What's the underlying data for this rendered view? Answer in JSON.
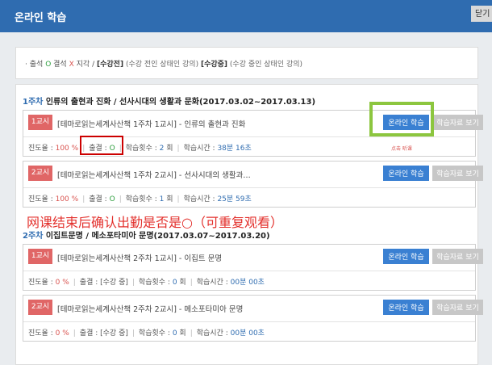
{
  "header": {
    "title": "온라인 학습",
    "close_label": "닫기"
  },
  "legend": {
    "bullet": "·",
    "attendance": "출석",
    "o": "O",
    "absent": "결석",
    "x": "X",
    "late": "지각",
    "slash": "/",
    "completed_tag": "[수강전]",
    "completed_desc": "(수강 전인 상태인 강의)",
    "ongoing_tag": "[수강중]",
    "ongoing_desc": "(수강 중인 상태인 강의)"
  },
  "weeks": [
    {
      "num": "1주차",
      "title": "인류의 출현과 진화 / 선사시대의 생활과 문화(2017.03.02~2017.03.13)",
      "lessons": [
        {
          "badge": "1교시",
          "title": "[테마로읽는세계사산책 1주차 1교시] - 인류의 출현과 진화",
          "progress_label": "진도율 :",
          "progress": "100 %",
          "att_label": "출결 :",
          "att": "O",
          "count_label": "학습횟수 :",
          "count": "2",
          "count_unit": "회",
          "time_label": "학습시간 :",
          "time": "38분 16초",
          "btn_study": "온라인 학습",
          "btn_material": "학습자료 보기"
        },
        {
          "badge": "2교시",
          "title": "[테마로읽는세계사산책 1주차 2교시] - 선사시대의 생활과…",
          "progress_label": "진도율 :",
          "progress": "100 %",
          "att_label": "출결 :",
          "att": "O",
          "count_label": "학습횟수 :",
          "count": "1",
          "count_unit": "회",
          "time_label": "학습시간 :",
          "time": "25분 59초",
          "btn_study": "온라인 학습",
          "btn_material": "학습자료 보기"
        }
      ]
    },
    {
      "num": "2주차",
      "title": "이집트문명 / 메소포타미아 문명(2017.03.07~2017.03.20)",
      "lessons": [
        {
          "badge": "1교시",
          "title": "[테마로읽는세계사산책 2주차 1교시] - 이집트 문명",
          "progress_label": "진도율 :",
          "progress": "0 %",
          "att_label": "출결 :",
          "att": "[수강 중]",
          "count_label": "학습횟수 :",
          "count": "0",
          "count_unit": "회",
          "time_label": "학습시간 :",
          "time": "00분 00초",
          "btn_study": "온라인 학습",
          "btn_material": "학습자료 보기"
        },
        {
          "badge": "2교시",
          "title": "[테마로읽는세계사산책 2주차 2교시] - 메소포타미아 문명",
          "progress_label": "진도율 :",
          "progress": "0 %",
          "att_label": "출결 :",
          "att": "[수강 중]",
          "count_label": "학습횟수 :",
          "count": "0",
          "count_unit": "회",
          "time_label": "학습시간 :",
          "time": "00분 00초",
          "btn_study": "온라인 학습",
          "btn_material": "학습자료 보기"
        }
      ]
    }
  ],
  "annotation": {
    "main": "网课结束后确认出勤是否是○（可重复观看）",
    "tiny": "点击 听课"
  },
  "colors": {
    "header": "#2f6cb0",
    "button": "#3a80d2",
    "badge": "#e06666",
    "highlight_green": "#8cc63f",
    "highlight_red": "#cc0000"
  }
}
